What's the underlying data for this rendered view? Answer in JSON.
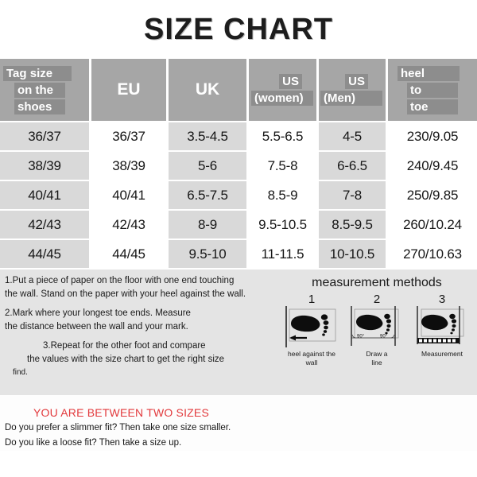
{
  "title": "SIZE CHART",
  "table": {
    "headers": [
      {
        "kind": "stacked",
        "align": "left",
        "lines": [
          "Tag size",
          "on the",
          "shoes"
        ]
      },
      {
        "kind": "plain",
        "label": "EU"
      },
      {
        "kind": "plain",
        "label": "UK"
      },
      {
        "kind": "stacked",
        "align": "right",
        "lines": [
          "US",
          "(women)"
        ]
      },
      {
        "kind": "stacked",
        "align": "right",
        "lines": [
          "US",
          "(Men)"
        ]
      },
      {
        "kind": "stacked",
        "align": "left",
        "lines": [
          "heel",
          "to",
          "toe"
        ]
      }
    ],
    "rows": [
      [
        "36/37",
        "36/37",
        "3.5-4.5",
        "5.5-6.5",
        "4-5",
        "230/9.05"
      ],
      [
        "38/39",
        "38/39",
        "5-6",
        "7.5-8",
        "6-6.5",
        "240/9.45"
      ],
      [
        "40/41",
        "40/41",
        "6.5-7.5",
        "8.5-9",
        "7-8",
        "250/9.85"
      ],
      [
        "42/43",
        "42/43",
        "8-9",
        "9.5-10.5",
        "8.5-9.5",
        "260/10.24"
      ],
      [
        "44/45",
        "44/45",
        "9.5-10",
        "11-11.5",
        "10-10.5",
        "270/10.63"
      ]
    ]
  },
  "instructions": {
    "step1_line1": "1.Put a piece of paper on the floor with one end touching",
    "step1_line2": "the wall. Stand on the paper with your heel against the wall.",
    "step2_line1": "2.Mark where your longest toe ends. Measure",
    "step2_line2": "the distance between the wall and your mark.",
    "step3_line1": "3.Repeat for the other foot and compare",
    "step3_line2": "the values with the size chart to get the right size",
    "step3_line3": "find."
  },
  "methods": {
    "title": "measurement methods",
    "diagrams": [
      {
        "number": "1",
        "caption_line1": "heel against the",
        "caption_line2": "wall",
        "angle_label": ""
      },
      {
        "number": "2",
        "caption_line1": "Draw a",
        "caption_line2": "line",
        "angle_label": "90°"
      },
      {
        "number": "3",
        "caption_line1": "Measurement",
        "caption_line2": "",
        "angle_label": ""
      }
    ]
  },
  "footer": {
    "between_sizes": "YOU ARE BETWEEN TWO SIZES",
    "slimmer": "Do you prefer a slimmer fit? Then take one size smaller.",
    "loose": "Do you like a loose fit? Then take a size up."
  },
  "colors": {
    "header_gray": "#a6a6a6",
    "highlight_gray": "#8d8d8d",
    "row_shade": "#d9d9d9",
    "band_gray": "#e4e4e4",
    "accent_red": "#e2393c"
  }
}
